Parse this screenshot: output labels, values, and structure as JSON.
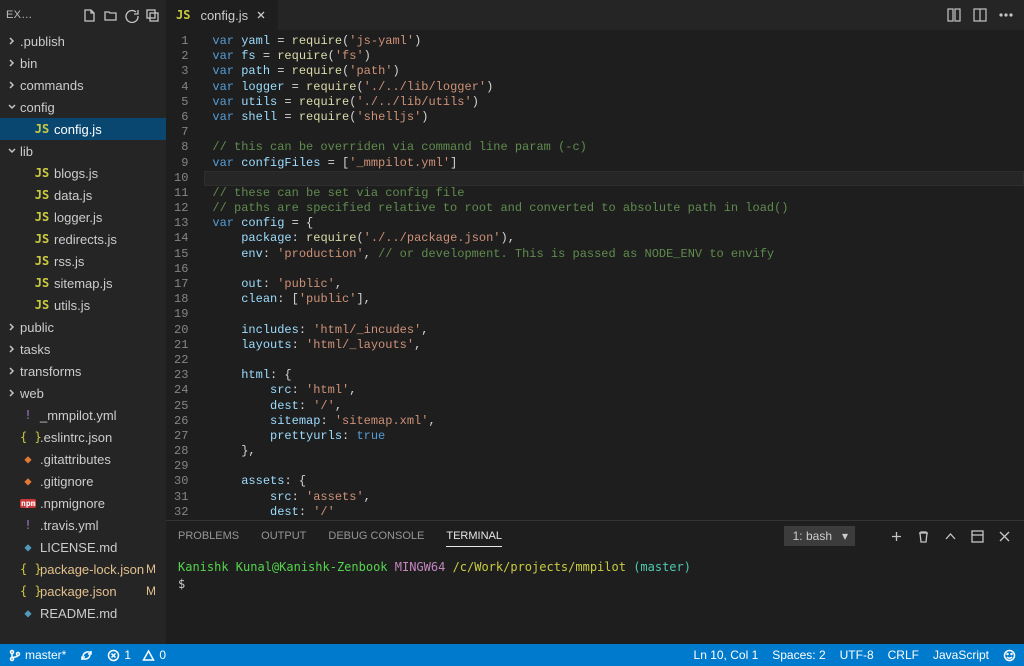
{
  "sidebar": {
    "title": "EX…",
    "tree": [
      {
        "d": 0,
        "tw": "r",
        "label": ".publish",
        "type": "folder"
      },
      {
        "d": 0,
        "tw": "r",
        "label": "bin",
        "type": "folder"
      },
      {
        "d": 0,
        "tw": "r",
        "label": "commands",
        "type": "folder"
      },
      {
        "d": 0,
        "tw": "d",
        "label": "config",
        "type": "folder"
      },
      {
        "d": 1,
        "label": "config.js",
        "type": "js",
        "sel": true
      },
      {
        "d": 0,
        "tw": "d",
        "label": "lib",
        "type": "folder"
      },
      {
        "d": 1,
        "label": "blogs.js",
        "type": "js"
      },
      {
        "d": 1,
        "label": "data.js",
        "type": "js"
      },
      {
        "d": 1,
        "label": "logger.js",
        "type": "js"
      },
      {
        "d": 1,
        "label": "redirects.js",
        "type": "js"
      },
      {
        "d": 1,
        "label": "rss.js",
        "type": "js"
      },
      {
        "d": 1,
        "label": "sitemap.js",
        "type": "js"
      },
      {
        "d": 1,
        "label": "utils.js",
        "type": "js"
      },
      {
        "d": 0,
        "tw": "r",
        "label": "public",
        "type": "folder"
      },
      {
        "d": 0,
        "tw": "r",
        "label": "tasks",
        "type": "folder"
      },
      {
        "d": 0,
        "tw": "r",
        "label": "transforms",
        "type": "folder"
      },
      {
        "d": 0,
        "tw": "r",
        "label": "web",
        "type": "folder"
      },
      {
        "d": 0,
        "label": "_mmpilot.yml",
        "type": "yml"
      },
      {
        "d": 0,
        "label": ".eslintrc.json",
        "type": "json"
      },
      {
        "d": 0,
        "label": ".gitattributes",
        "type": "git"
      },
      {
        "d": 0,
        "label": ".gitignore",
        "type": "git"
      },
      {
        "d": 0,
        "label": ".npmignore",
        "type": "npm"
      },
      {
        "d": 0,
        "label": ".travis.yml",
        "type": "yml"
      },
      {
        "d": 0,
        "label": "LICENSE.md",
        "type": "md"
      },
      {
        "d": 0,
        "label": "package-lock.json",
        "type": "json",
        "mod": true
      },
      {
        "d": 0,
        "label": "package.json",
        "type": "json",
        "mod": true
      },
      {
        "d": 0,
        "label": "README.md",
        "type": "md"
      }
    ]
  },
  "tab": {
    "icon": "JS",
    "name": "config.js"
  },
  "code": [
    [
      [
        "kw",
        "var "
      ],
      [
        "id",
        "yaml"
      ],
      [
        "pu",
        " = "
      ],
      [
        "fn",
        "require"
      ],
      [
        "pu",
        "("
      ],
      [
        "str",
        "'js-yaml'"
      ],
      [
        "pu",
        ")"
      ]
    ],
    [
      [
        "kw",
        "var "
      ],
      [
        "id",
        "fs"
      ],
      [
        "pu",
        " = "
      ],
      [
        "fn",
        "require"
      ],
      [
        "pu",
        "("
      ],
      [
        "str",
        "'fs'"
      ],
      [
        "pu",
        ")"
      ]
    ],
    [
      [
        "kw",
        "var "
      ],
      [
        "id",
        "path"
      ],
      [
        "pu",
        " = "
      ],
      [
        "fn",
        "require"
      ],
      [
        "pu",
        "("
      ],
      [
        "str",
        "'path'"
      ],
      [
        "pu",
        ")"
      ]
    ],
    [
      [
        "kw",
        "var "
      ],
      [
        "id",
        "logger"
      ],
      [
        "pu",
        " = "
      ],
      [
        "fn",
        "require"
      ],
      [
        "pu",
        "("
      ],
      [
        "str",
        "'./../lib/logger'"
      ],
      [
        "pu",
        ")"
      ]
    ],
    [
      [
        "kw",
        "var "
      ],
      [
        "id",
        "utils"
      ],
      [
        "pu",
        " = "
      ],
      [
        "fn",
        "require"
      ],
      [
        "pu",
        "("
      ],
      [
        "str",
        "'./../lib/utils'"
      ],
      [
        "pu",
        ")"
      ]
    ],
    [
      [
        "kw",
        "var "
      ],
      [
        "id",
        "shell"
      ],
      [
        "pu",
        " = "
      ],
      [
        "fn",
        "require"
      ],
      [
        "pu",
        "("
      ],
      [
        "str",
        "'shelljs'"
      ],
      [
        "pu",
        ")"
      ]
    ],
    [],
    [
      [
        "cm",
        "// this can be overriden via command line param (-c)"
      ]
    ],
    [
      [
        "kw",
        "var "
      ],
      [
        "id",
        "configFiles"
      ],
      [
        "pu",
        " = ["
      ],
      [
        "str",
        "'_mmpilot.yml'"
      ],
      [
        "pu",
        "]"
      ]
    ],
    [],
    [
      [
        "cm",
        "// these can be set via config file"
      ]
    ],
    [
      [
        "cm",
        "// paths are specified relative to root and converted to absolute path in load()"
      ]
    ],
    [
      [
        "kw",
        "var "
      ],
      [
        "id",
        "config"
      ],
      [
        "pu",
        " = {"
      ]
    ],
    [
      [
        "pu",
        "    "
      ],
      [
        "id",
        "package"
      ],
      [
        "pu",
        ": "
      ],
      [
        "fn",
        "require"
      ],
      [
        "pu",
        "("
      ],
      [
        "str",
        "'./../package.json'"
      ],
      [
        "pu",
        "),"
      ]
    ],
    [
      [
        "pu",
        "    "
      ],
      [
        "id",
        "env"
      ],
      [
        "pu",
        ": "
      ],
      [
        "str",
        "'production'"
      ],
      [
        "pu",
        ", "
      ],
      [
        "cm",
        "// or development. This is passed as NODE_ENV to envify"
      ]
    ],
    [],
    [
      [
        "pu",
        "    "
      ],
      [
        "id",
        "out"
      ],
      [
        "pu",
        ": "
      ],
      [
        "str",
        "'public'"
      ],
      [
        "pu",
        ","
      ]
    ],
    [
      [
        "pu",
        "    "
      ],
      [
        "id",
        "clean"
      ],
      [
        "pu",
        ": ["
      ],
      [
        "str",
        "'public'"
      ],
      [
        "pu",
        "],"
      ]
    ],
    [],
    [
      [
        "pu",
        "    "
      ],
      [
        "id",
        "includes"
      ],
      [
        "pu",
        ": "
      ],
      [
        "str",
        "'html/_incudes'"
      ],
      [
        "pu",
        ","
      ]
    ],
    [
      [
        "pu",
        "    "
      ],
      [
        "id",
        "layouts"
      ],
      [
        "pu",
        ": "
      ],
      [
        "str",
        "'html/_layouts'"
      ],
      [
        "pu",
        ","
      ]
    ],
    [],
    [
      [
        "pu",
        "    "
      ],
      [
        "id",
        "html"
      ],
      [
        "pu",
        ": {"
      ]
    ],
    [
      [
        "pu",
        "        "
      ],
      [
        "id",
        "src"
      ],
      [
        "pu",
        ": "
      ],
      [
        "str",
        "'html'"
      ],
      [
        "pu",
        ","
      ]
    ],
    [
      [
        "pu",
        "        "
      ],
      [
        "id",
        "dest"
      ],
      [
        "pu",
        ": "
      ],
      [
        "str",
        "'/'"
      ],
      [
        "pu",
        ","
      ]
    ],
    [
      [
        "pu",
        "        "
      ],
      [
        "id",
        "sitemap"
      ],
      [
        "pu",
        ": "
      ],
      [
        "str",
        "'sitemap.xml'"
      ],
      [
        "pu",
        ","
      ]
    ],
    [
      [
        "pu",
        "        "
      ],
      [
        "id",
        "prettyurls"
      ],
      [
        "pu",
        ": "
      ],
      [
        "lit",
        "true"
      ]
    ],
    [
      [
        "pu",
        "    },"
      ]
    ],
    [],
    [
      [
        "pu",
        "    "
      ],
      [
        "id",
        "assets"
      ],
      [
        "pu",
        ": {"
      ]
    ],
    [
      [
        "pu",
        "        "
      ],
      [
        "id",
        "src"
      ],
      [
        "pu",
        ": "
      ],
      [
        "str",
        "'assets'"
      ],
      [
        "pu",
        ","
      ]
    ],
    [
      [
        "pu",
        "        "
      ],
      [
        "id",
        "dest"
      ],
      [
        "pu",
        ": "
      ],
      [
        "str",
        "'/'"
      ]
    ],
    [
      [
        "pu",
        "    },"
      ]
    ],
    []
  ],
  "highlight_line": 10,
  "panel": {
    "tabs": [
      "PROBLEMS",
      "OUTPUT",
      "DEBUG CONSOLE",
      "TERMINAL"
    ],
    "active": 3,
    "select": "1: bash"
  },
  "terminal": {
    "user": "Kanishk Kunal@Kanishk-Zenbook",
    "host": "MINGW64",
    "path": "/c/Work/projects/mmpilot",
    "branch": "(master)",
    "prompt": "$"
  },
  "status": {
    "branch": "master*",
    "errors": "1",
    "warnings": "0",
    "cursor": "Ln 10, Col 1",
    "spaces": "Spaces: 2",
    "encoding": "UTF-8",
    "eol": "CRLF",
    "lang": "JavaScript"
  }
}
